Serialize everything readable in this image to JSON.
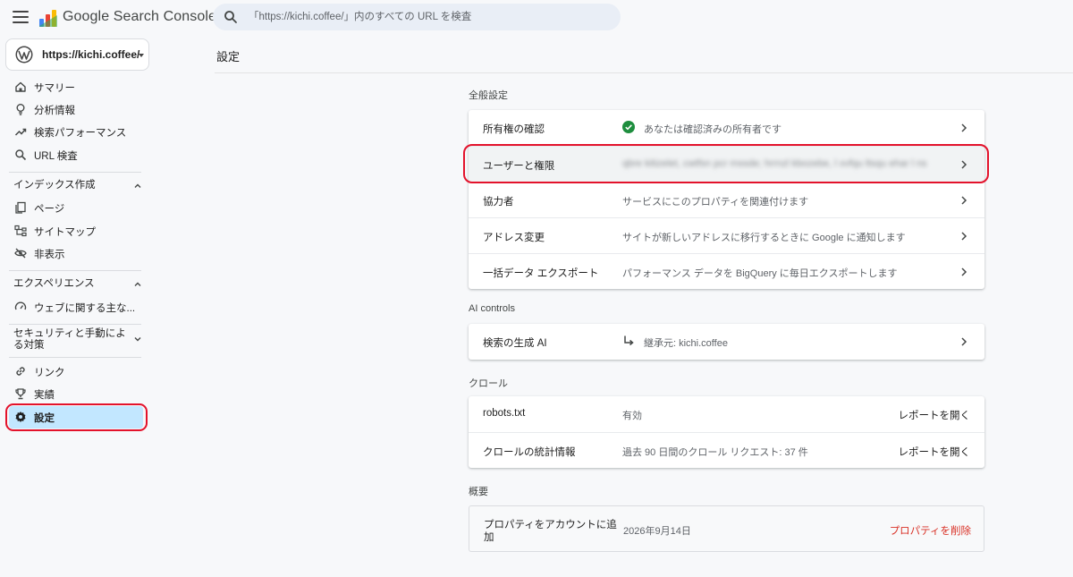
{
  "app": {
    "product_name": "Google Search Console"
  },
  "search": {
    "placeholder": "「https://kichi.coffee/」内のすべての URL を検査"
  },
  "property": {
    "label": "https://kichi.coffee/"
  },
  "sidebar": {
    "items": [
      {
        "label": "サマリー",
        "icon": "home-icon"
      },
      {
        "label": "分析情報",
        "icon": "lightbulb-icon"
      },
      {
        "label": "検索パフォーマンス",
        "icon": "trending-up-icon"
      },
      {
        "label": "URL 検査",
        "icon": "search-icon"
      }
    ],
    "sections": {
      "index": {
        "title": "インデックス作成",
        "items": [
          {
            "label": "ページ",
            "icon": "pages-icon"
          },
          {
            "label": "サイトマップ",
            "icon": "sitemap-icon"
          },
          {
            "label": "非表示",
            "icon": "eye-off-icon"
          }
        ]
      },
      "experience": {
        "title": "エクスペリエンス",
        "items": [
          {
            "label": "ウェブに関する主な...",
            "icon": "speed-icon"
          }
        ]
      },
      "security": {
        "title_line1": "セキュリティと手動によ",
        "title_line2": "る対策"
      },
      "links": {
        "label": "リンク",
        "icon": "link-icon"
      },
      "achievements": {
        "label": "実績",
        "icon": "trophy-icon"
      },
      "settings": {
        "label": "設定",
        "icon": "gear-icon"
      }
    }
  },
  "page": {
    "title": "設定"
  },
  "general": {
    "heading": "全般設定",
    "rows": [
      {
        "name": "所有権の確認",
        "value": "あなたは確認済みの所有者です"
      },
      {
        "name": "ユーザーと権限",
        "value": "qbre kitizelet, cwtfsn pcr mssde; hrrnzl kbozebe, l xvfqu ltsqu ehar l ns"
      },
      {
        "name": "協力者",
        "value": "サービスにこのプロパティを関連付けます"
      },
      {
        "name": "アドレス変更",
        "value": "サイトが新しいアドレスに移行するときに Google に通知します"
      },
      {
        "name": "一括データ エクスポート",
        "value": "パフォーマンス データを BigQuery に毎日エクスポートします"
      }
    ]
  },
  "ai": {
    "heading": "AI controls",
    "rows": [
      {
        "name": "検索の生成 AI",
        "value": "継承元: kichi.coffee"
      }
    ]
  },
  "crawl": {
    "heading": "クロール",
    "rows": [
      {
        "name": "robots.txt",
        "value": "有効",
        "action": "レポートを開く"
      },
      {
        "name": "クロールの統計情報",
        "value": "過去 90 日間のクロール リクエスト: 37 件",
        "action": "レポートを開く"
      }
    ]
  },
  "overview": {
    "heading": "概要",
    "rows": [
      {
        "name_line1": "プロパティをアカウントに追",
        "name_line2": "加",
        "value": "2026年9月14日",
        "action": "プロパティを削除"
      }
    ]
  },
  "colors": {
    "accent": "#1a73e8",
    "active_nav": "#c2e7ff",
    "highlight": "#e3122b",
    "check": "#1e8e3e",
    "danger": "#d93025"
  }
}
